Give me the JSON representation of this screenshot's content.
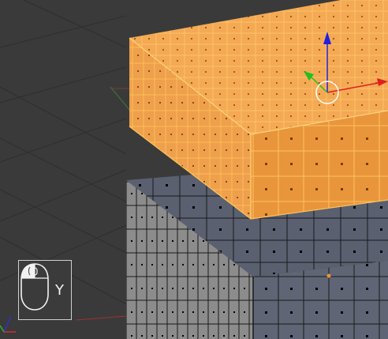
{
  "viewport": {
    "background_color": "#3a3a3a",
    "grid_line_color": "#333333",
    "selected_mesh_color": "#f2a64f",
    "selected_edge_color": "#ffc35a",
    "unselected_mesh_color": "#5b6170",
    "manipulator": {
      "x_axis_color": "#e02020",
      "y_axis_color": "#20c020",
      "z_axis_color": "#2020e0",
      "handle_icon": "circle-icon"
    }
  },
  "input_overlay": {
    "icon": "mouse-icon",
    "key_label": "Y"
  }
}
